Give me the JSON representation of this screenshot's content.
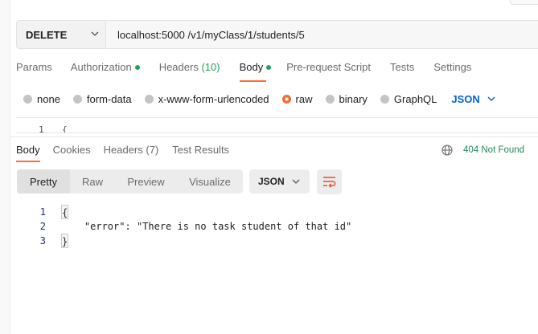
{
  "request": {
    "method": "DELETE",
    "url": "localhost:5000 /v1/myClass/1/students/5"
  },
  "request_tabs": [
    {
      "label": "Params"
    },
    {
      "label": "Authorization"
    },
    {
      "label": "Headers",
      "count": "(10)"
    },
    {
      "label": "Body"
    },
    {
      "label": "Pre-request Script"
    },
    {
      "label": "Tests"
    },
    {
      "label": "Settings"
    }
  ],
  "body_types": [
    "none",
    "form-data",
    "x-www-form-urlencoded",
    "raw",
    "binary",
    "GraphQL"
  ],
  "body_format": "JSON",
  "editor": {
    "line_number": "1",
    "text": "{"
  },
  "response_tabs": [
    {
      "label": "Body"
    },
    {
      "label": "Cookies"
    },
    {
      "label": "Headers (7)"
    },
    {
      "label": "Test Results"
    }
  ],
  "status": {
    "text": "404 Not Found",
    "color": "#22895b"
  },
  "view_modes": [
    "Pretty",
    "Raw",
    "Preview",
    "Visualize"
  ],
  "response_format": "JSON",
  "response_body": {
    "line_numbers": [
      "1",
      "2",
      "3"
    ],
    "open_brace": "{",
    "key": "\"error\"",
    "colon": ": ",
    "value": "\"There is no task student of that id\"",
    "close_brace": "}"
  },
  "colors": {
    "accent": "#ff6c37",
    "success": "#22a35a",
    "link": "#0265d2"
  }
}
